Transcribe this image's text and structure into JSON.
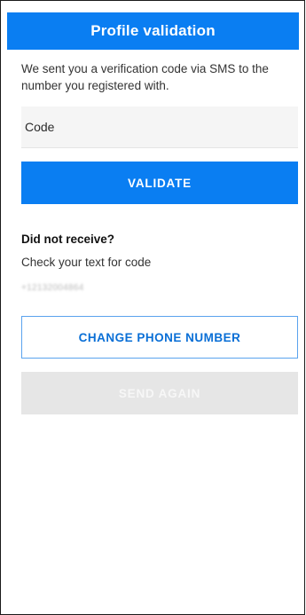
{
  "header": {
    "title": "Profile validation"
  },
  "intro": {
    "text": "We sent you a verification code via SMS to the number you registered with."
  },
  "code_input": {
    "placeholder": "Code",
    "value": ""
  },
  "validate_button": {
    "label": "VALIDATE"
  },
  "resend_section": {
    "heading": "Did not receive?",
    "instruction": "Check your text for code",
    "phone_number": "+12132004864"
  },
  "change_phone_button": {
    "label": "CHANGE PHONE NUMBER"
  },
  "send_again_button": {
    "label": "SEND AGAIN",
    "state": "disabled"
  },
  "colors": {
    "accent": "#0a7ef2",
    "disabled_bg": "#e6e6e6"
  }
}
